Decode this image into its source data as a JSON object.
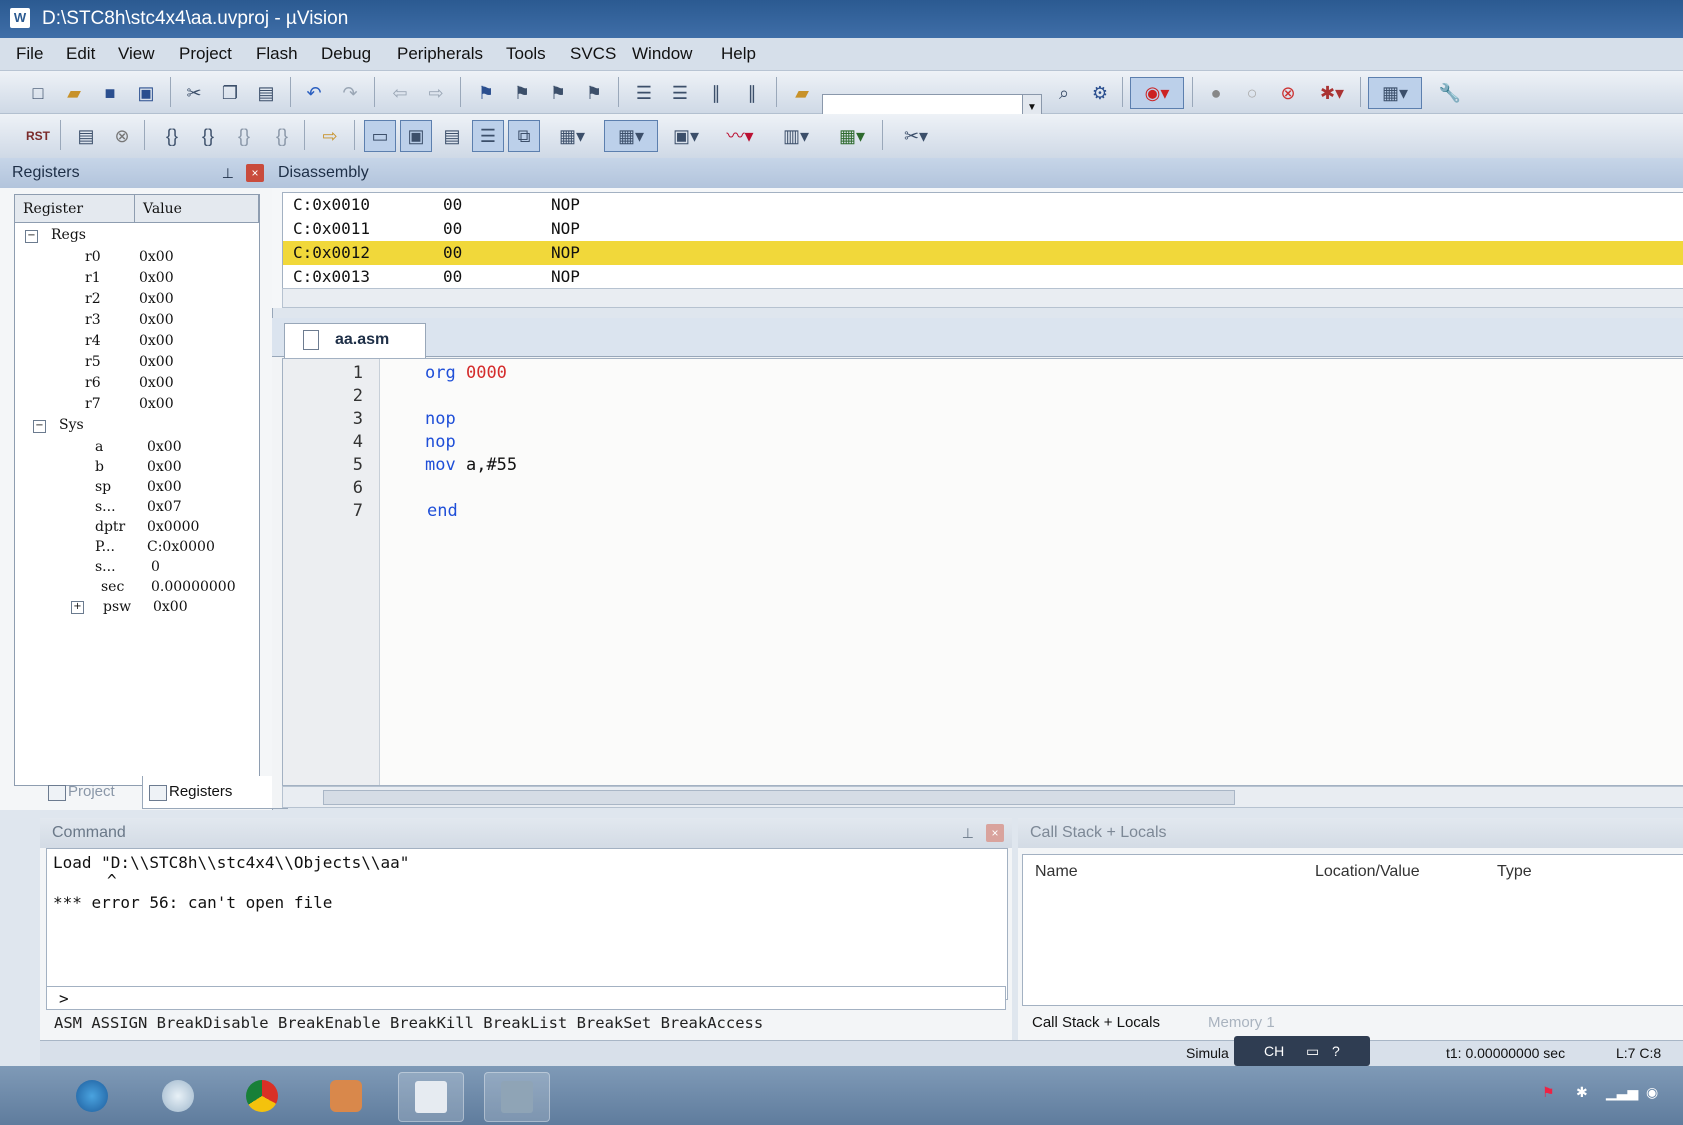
{
  "window": {
    "title": "D:\\STC8h\\stc4x4\\aa.uvproj - µVision"
  },
  "menu": [
    "File",
    "Edit",
    "View",
    "Project",
    "Flash",
    "Debug",
    "Peripherals",
    "Tools",
    "SVCS",
    "Window",
    "Help"
  ],
  "toolbar": {
    "rst_label": "RST"
  },
  "registers": {
    "title": "Registers",
    "columns": [
      "Register",
      "Value"
    ],
    "groups": [
      {
        "name": "Regs",
        "items": [
          {
            "name": "r0",
            "value": "0x00"
          },
          {
            "name": "r1",
            "value": "0x00"
          },
          {
            "name": "r2",
            "value": "0x00"
          },
          {
            "name": "r3",
            "value": "0x00"
          },
          {
            "name": "r4",
            "value": "0x00"
          },
          {
            "name": "r5",
            "value": "0x00"
          },
          {
            "name": "r6",
            "value": "0x00"
          },
          {
            "name": "r7",
            "value": "0x00"
          }
        ]
      },
      {
        "name": "Sys",
        "items": [
          {
            "name": "a",
            "value": "0x00"
          },
          {
            "name": "b",
            "value": "0x00"
          },
          {
            "name": "sp",
            "value": "0x00"
          },
          {
            "name": "s...",
            "value": "0x07"
          },
          {
            "name": "dptr",
            "value": "0x0000"
          },
          {
            "name": "P...",
            "value": "C:0x0000"
          },
          {
            "name": "s...",
            "value": "0"
          },
          {
            "name": "sec",
            "value": "0.00000000"
          },
          {
            "name": "psw",
            "value": "0x00"
          }
        ]
      }
    ],
    "tabs": [
      "Project",
      "Registers"
    ]
  },
  "disassembly": {
    "title": "Disassembly",
    "rows": [
      {
        "addr": "C:0x0010",
        "code": "00",
        "instr": "NOP"
      },
      {
        "addr": "C:0x0011",
        "code": "00",
        "instr": "NOP"
      },
      {
        "addr": "C:0x0012",
        "code": "00",
        "instr": "NOP"
      },
      {
        "addr": "C:0x0013",
        "code": "00",
        "instr": "NOP"
      }
    ]
  },
  "editor": {
    "tab": "aa.asm",
    "lines": [
      {
        "n": "1",
        "kw": "org",
        "arg": "0000"
      },
      {
        "n": "2",
        "kw": "",
        "arg": ""
      },
      {
        "n": "3",
        "kw": "nop",
        "arg": ""
      },
      {
        "n": "4",
        "kw": "nop",
        "arg": ""
      },
      {
        "n": "5",
        "kw": "mov",
        "arg": "a,#55"
      },
      {
        "n": "6",
        "kw": "",
        "arg": ""
      },
      {
        "n": "7",
        "kw": "end",
        "arg": ""
      }
    ]
  },
  "command": {
    "title": "Command",
    "output": [
      "Load \"D:\\\\STC8h\\\\stc4x4\\\\Objects\\\\aa\"",
      "^",
      "*** error 56: can't open file"
    ],
    "prompt": ">",
    "hint": "ASM ASSIGN BreakDisable BreakEnable BreakKill BreakList BreakSet BreakAccess"
  },
  "callstack": {
    "title": "Call Stack + Locals",
    "columns": [
      "Name",
      "Location/Value",
      "Type"
    ],
    "tabs": [
      "Call Stack + Locals",
      "Memory 1"
    ]
  },
  "status": {
    "mode": "Simula",
    "ime": "CH",
    "time": "t1: 0.00000000 sec",
    "pos": "L:7 C:8"
  }
}
